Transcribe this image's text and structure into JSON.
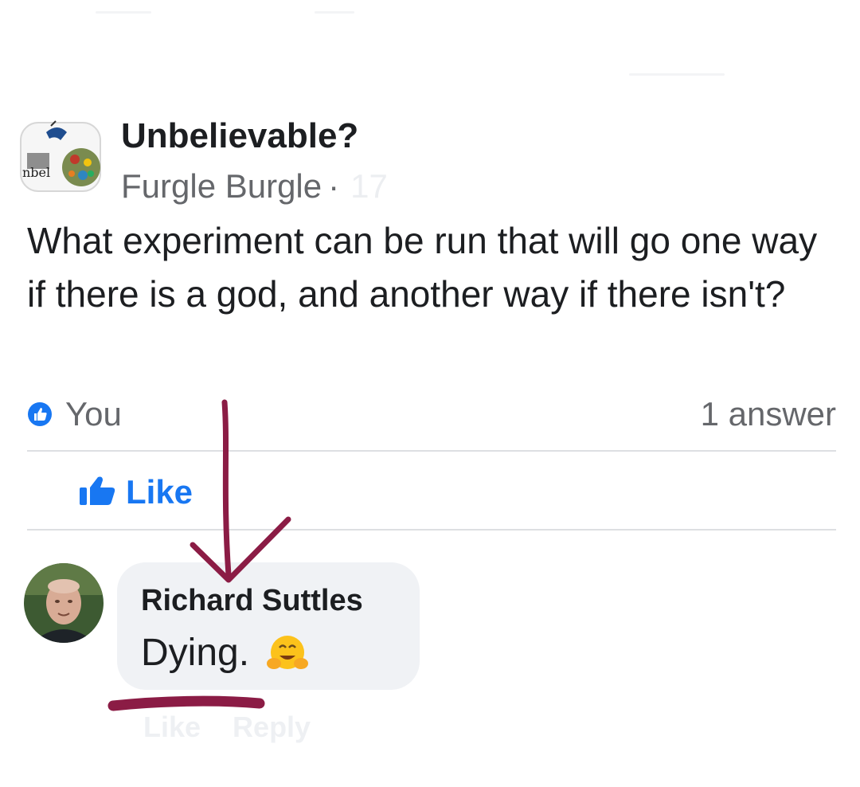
{
  "post": {
    "group_name": "Unbelievable?",
    "author": "Furgle Burgle",
    "separator": "·",
    "time": "17",
    "body": "What experiment can be run that will go one way if there is a god, and another way if there isn't?",
    "reactions_label": "You",
    "answers_count": "1 answer",
    "like_label": "Like",
    "group_avatar_text": "nbel"
  },
  "comment": {
    "author": "Richard Suttles",
    "text": "Dying.",
    "emoji": "hugging-face-icon",
    "like_label": "Like",
    "reply_label": "Reply"
  },
  "colors": {
    "accent": "#1877f2",
    "annotation": "#8b1c45",
    "bubble": "#f0f2f5",
    "meta_text": "#65676b"
  }
}
